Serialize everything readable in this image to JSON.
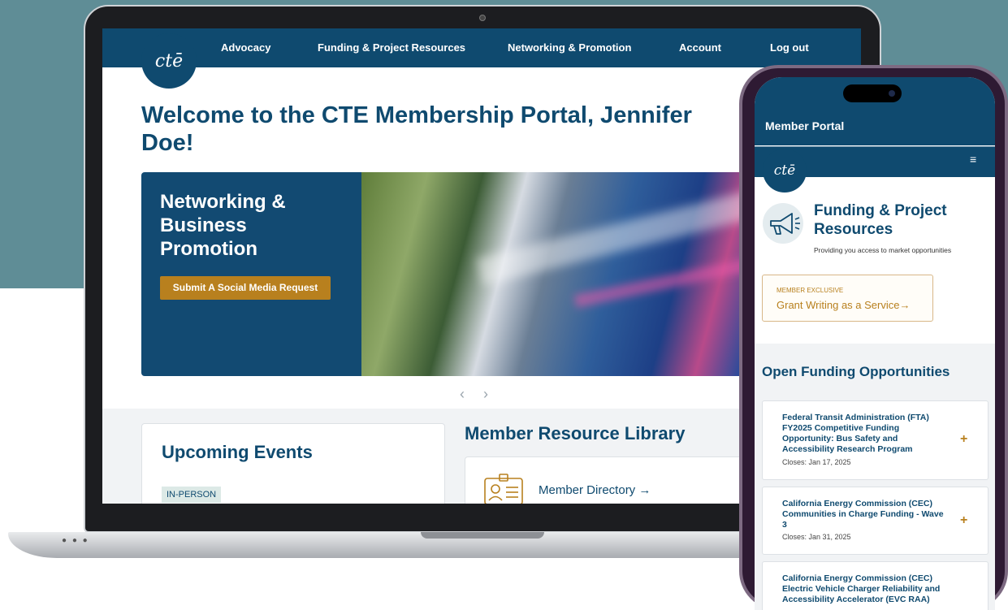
{
  "laptop": {
    "nav": {
      "logo": "ctē",
      "items": [
        "Advocacy",
        "Funding & Project Resources",
        "Networking & Promotion",
        "Account",
        "Log out"
      ]
    },
    "welcome": "Welcome to the CTE Membership Portal, Jennifer Doe!",
    "hero": {
      "title": "Networking & Business Promotion",
      "button": "Submit A Social Media Request"
    },
    "carousel": {
      "prev": "‹",
      "next": "›"
    },
    "events": {
      "title": "Upcoming Events",
      "badge": "IN-PERSON"
    },
    "library": {
      "title": "Member Resource Library",
      "directory_link": "Member Directory →"
    }
  },
  "phone": {
    "header_title": "Member Portal",
    "logo": "ctē",
    "menu": "≡",
    "section": {
      "title": "Funding & Project Resources",
      "subtitle": "Providing you access to market opportunities"
    },
    "exclusive": {
      "label": "MEMBER EXCLUSIVE",
      "link": "Grant Writing as a Service→"
    },
    "open_title": "Open Funding Opportunities",
    "opportunities": [
      {
        "name": "Federal Transit Administration (FTA) FY2025 Competitive Funding Opportunity: Bus Safety and Accessibility Research Program",
        "closes": "Closes: Jan 17, 2025"
      },
      {
        "name": "California Energy Commission (CEC) Communities in Charge Funding - Wave 3",
        "closes": "Closes: Jan 31, 2025"
      },
      {
        "name": "California Energy Commission (CEC) Electric Vehicle Charger Reliability and Accessibility Accelerator (EVC RAA)",
        "closes": ""
      }
    ],
    "plus": "+"
  },
  "colors": {
    "brand_navy": "#0f4a6f",
    "accent_gold": "#b8801e",
    "backdrop_teal": "#5f8d96"
  }
}
